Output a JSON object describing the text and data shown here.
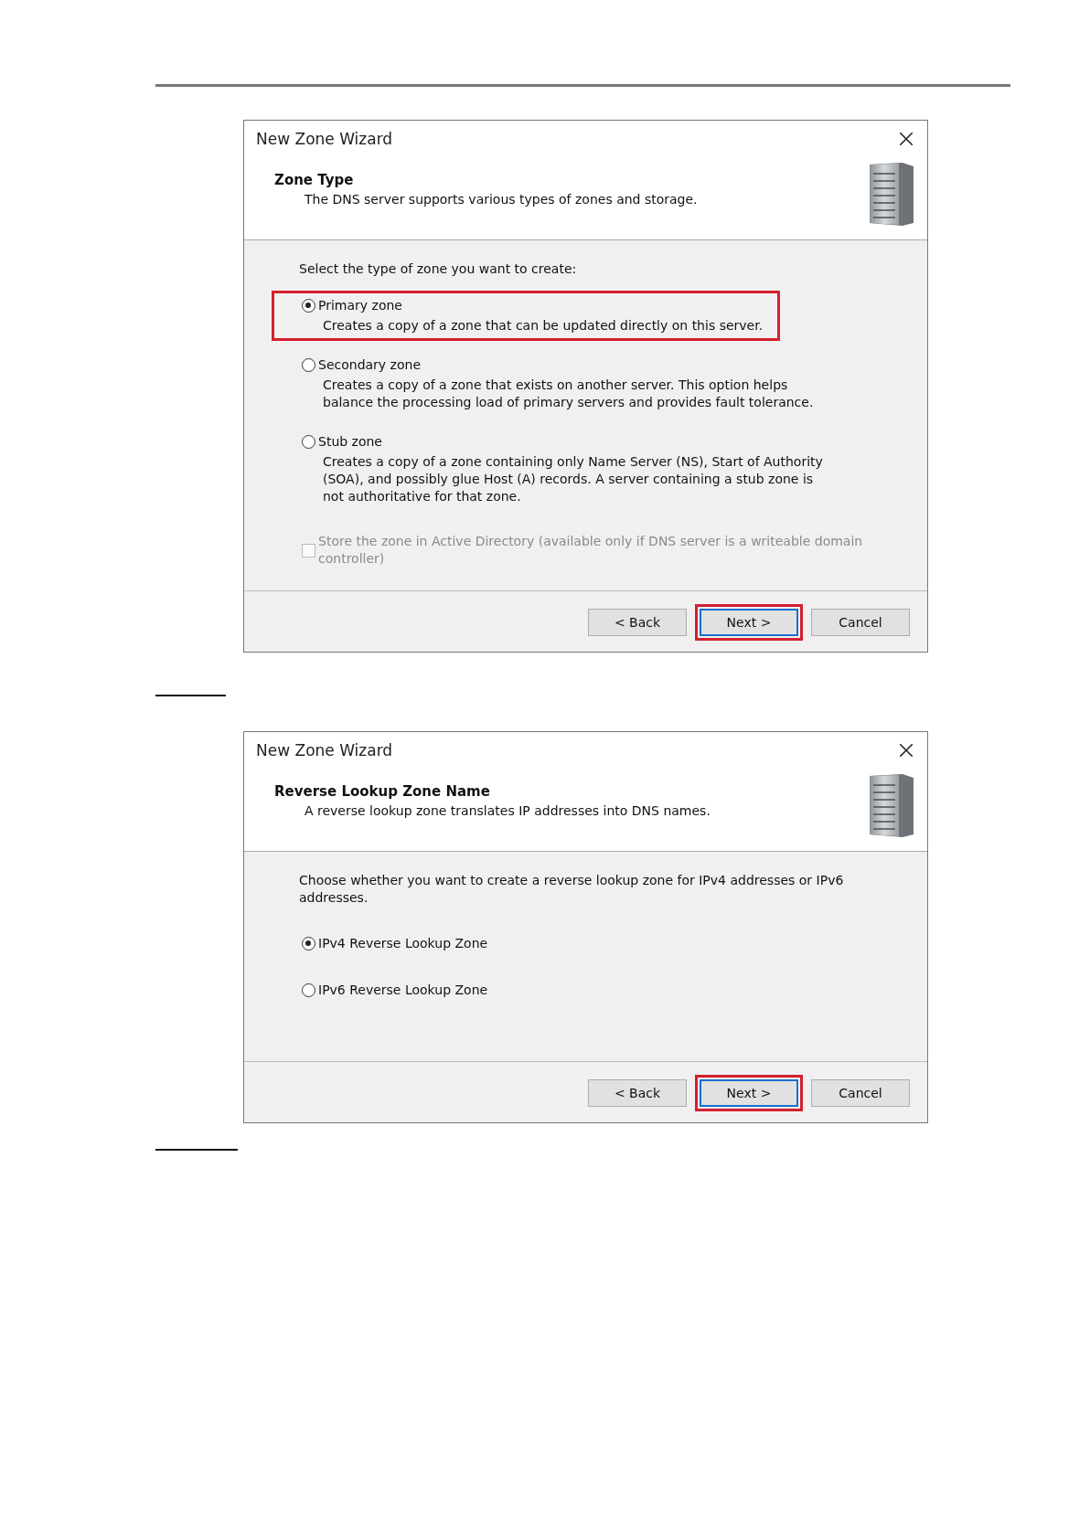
{
  "dialogs": [
    {
      "title": "New Zone Wizard",
      "heading": "Zone Type",
      "subtitle": "The DNS server supports various types of zones and storage.",
      "prompt": "Select the type of zone you want to create:",
      "options": [
        {
          "kind": "radio",
          "label": "Primary zone",
          "description": "Creates a copy of a zone that can be updated directly on this server.",
          "selected": true,
          "highlighted": true,
          "disabled": false
        },
        {
          "kind": "radio",
          "label": "Secondary zone",
          "description": "Creates a copy of a zone that exists on another server. This option helps balance the processing load of primary servers and provides fault tolerance.",
          "selected": false,
          "highlighted": false,
          "disabled": false
        },
        {
          "kind": "radio",
          "label": "Stub zone",
          "description": "Creates a copy of a zone containing only Name Server (NS), Start of Authority (SOA), and possibly glue Host (A) records. A server containing a stub zone is not authoritative for that zone.",
          "selected": false,
          "highlighted": false,
          "disabled": false
        },
        {
          "kind": "checkbox",
          "label": "Store the zone in Active Directory (available only if DNS server is a writeable domain controller)",
          "checked": false,
          "highlighted": false,
          "disabled": true
        }
      ],
      "buttons": [
        {
          "label": "< Back",
          "highlighted": false,
          "default": false
        },
        {
          "label": "Next >",
          "highlighted": true,
          "default": true
        },
        {
          "label": "Cancel",
          "highlighted": false,
          "default": false
        }
      ]
    },
    {
      "title": "New Zone Wizard",
      "heading": "Reverse Lookup Zone Name",
      "subtitle": "A reverse lookup zone translates IP addresses into DNS names.",
      "prompt": "Choose whether you want to create a reverse lookup zone for IPv4 addresses or IPv6 addresses.",
      "options": [
        {
          "kind": "radio",
          "label": "IPv4 Reverse Lookup Zone",
          "selected": true,
          "highlighted": false,
          "disabled": false
        },
        {
          "kind": "radio",
          "label": "IPv6 Reverse Lookup Zone",
          "selected": false,
          "highlighted": false,
          "disabled": false
        }
      ],
      "buttons": [
        {
          "label": "< Back",
          "highlighted": false,
          "default": false
        },
        {
          "label": "Next >",
          "highlighted": true,
          "default": true
        },
        {
          "label": "Cancel",
          "highlighted": false,
          "default": false
        }
      ]
    }
  ]
}
